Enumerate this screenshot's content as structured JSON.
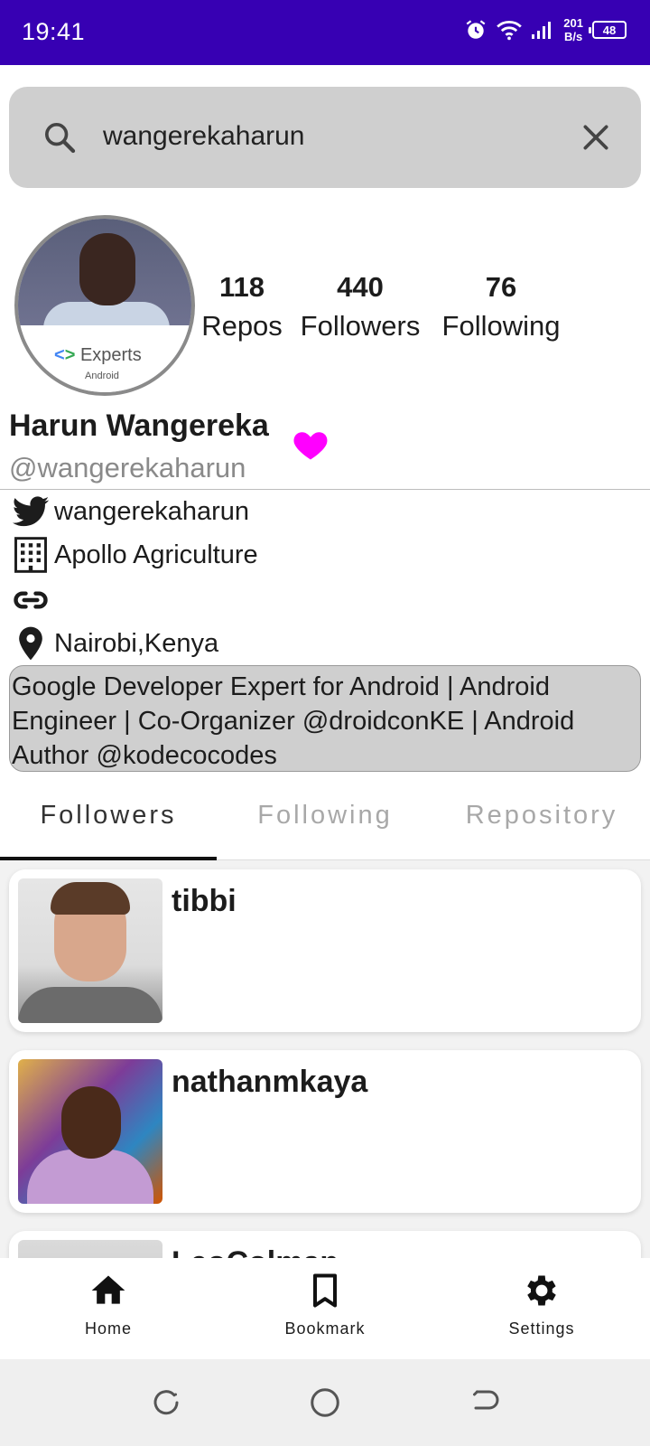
{
  "status_bar": {
    "time": "19:41",
    "net_speed_value": "201",
    "net_speed_unit": "B/s",
    "battery": "48"
  },
  "search": {
    "query": "wangerekaharun"
  },
  "avatar": {
    "badge_text": "Experts",
    "badge_sub": "Android"
  },
  "stats": [
    {
      "value": "118",
      "label": "Repos"
    },
    {
      "value": "440",
      "label": "Followers"
    },
    {
      "value": "76",
      "label": "Following"
    }
  ],
  "profile": {
    "name": "Harun Wangereka",
    "handle": "@wangerekaharun",
    "twitter": "wangerekaharun",
    "company": "Apollo Agriculture",
    "blog": "",
    "location": "Nairobi,Kenya",
    "bio": "Google Developer Expert for Android | Android Engineer | Co-Organizer @droidconKE  | Android Author @kodecocodes",
    "heart_color": "#ff00ff"
  },
  "tabs": [
    {
      "label": "Followers",
      "active": true
    },
    {
      "label": "Following",
      "active": false
    },
    {
      "label": "Repository",
      "active": false
    }
  ],
  "followers": [
    {
      "login": "tibbi"
    },
    {
      "login": "nathanmkaya"
    },
    {
      "login": "LeoColman"
    }
  ],
  "bottom_nav": {
    "home": "Home",
    "bookmark": "Bookmark",
    "settings": "Settings"
  },
  "colors": {
    "status_bar": "#3700b3",
    "search_bg": "#cfcfcf",
    "accent_heart": "#ff00ff"
  }
}
